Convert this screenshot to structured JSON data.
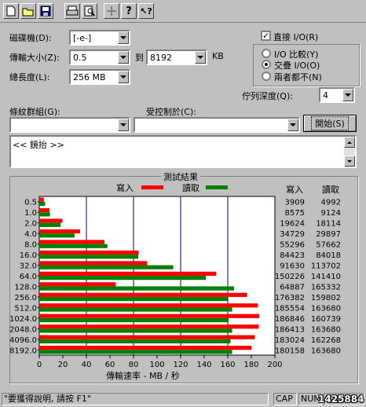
{
  "toolbar": {
    "buttons": [
      {
        "name": "new-file-icon",
        "glyph": "🗋"
      },
      {
        "name": "open-folder-icon",
        "glyph": "📂"
      },
      {
        "name": "save-icon",
        "glyph": "💾"
      },
      {
        "name": "print-icon",
        "glyph": "🖶"
      },
      {
        "name": "print-preview-icon",
        "glyph": "🔍"
      },
      {
        "name": "move-icon",
        "glyph": "✥"
      },
      {
        "name": "help-icon",
        "glyph": "?"
      },
      {
        "name": "context-help-icon",
        "glyph": "↖?"
      }
    ]
  },
  "settings": {
    "drive_label": "磁碟機(D):",
    "drive_value": "[-e-]",
    "transfer_label": "傳輸大小(Z):",
    "transfer_from": "0.5",
    "to_label": "到",
    "transfer_to": "8192",
    "kb_label": "KB",
    "length_label": "總長度(L):",
    "length_value": "256 MB",
    "direct_io_label": "直接 I/O(R)",
    "direct_io_checked": true,
    "radio_io_compare": "I/O 比較(Y)",
    "radio_overlap": "交疊 I/O(O)",
    "radio_neither": "兩者都不(N)",
    "queue_label": "佇列深度(Q):",
    "queue_value": "4",
    "group_label": "條紋群組(G):",
    "control_label": "受控制於(C):",
    "start_button": "開始(S)",
    "log_text": "<< 鏡抬 >>"
  },
  "chart_data": {
    "type": "bar",
    "title": "測試結果",
    "legend": [
      {
        "name": "寫入",
        "color": "#ff0000"
      },
      {
        "name": "讀取",
        "color": "#008000"
      }
    ],
    "xlabel": "傳輸速率 - MB / 秒",
    "xlim": [
      0,
      200
    ],
    "xticks": [
      "0",
      "20",
      "40",
      "60",
      "80",
      "100",
      "120",
      "140",
      "160",
      "180",
      "200"
    ],
    "categories": [
      "0.5",
      "1.0",
      "2.0",
      "4.0",
      "8.0",
      "16.0",
      "32.0",
      "64.0",
      "128.0",
      "256.0",
      "512.0",
      "1024.0",
      "2048.0",
      "4096.0",
      "8192.0"
    ],
    "series": [
      {
        "name": "寫入",
        "color": "#ff0000",
        "values": [
          3.9,
          8.6,
          19.6,
          34.7,
          55.3,
          84.4,
          91.6,
          150.2,
          64.9,
          176.4,
          185.6,
          186.8,
          186.4,
          183.0,
          180.2
        ]
      },
      {
        "name": "讀取",
        "color": "#008000",
        "values": [
          5.0,
          9.1,
          18.1,
          29.9,
          57.8,
          84.0,
          113.7,
          141.4,
          165.3,
          159.8,
          163.7,
          160.7,
          163.7,
          162.3,
          163.7
        ]
      }
    ],
    "table_headers": {
      "write": "寫入",
      "read": "讀取"
    },
    "write_values": [
      "3909",
      "8575",
      "19624",
      "34729",
      "55296",
      "84423",
      "91630",
      "150226",
      "64887",
      "176382",
      "185554",
      "186846",
      "186413",
      "183024",
      "180158"
    ],
    "read_values": [
      "4992",
      "9124",
      "18114",
      "29897",
      "57662",
      "84018",
      "113702",
      "141410",
      "165332",
      "159802",
      "163680",
      "160739",
      "163680",
      "162268",
      "163680"
    ],
    "grid": true
  },
  "status": {
    "help_text": "\"要獲得說明, 請按 F1\"",
    "cap": "CAP",
    "num": "NUM",
    "watermark": "1425884"
  },
  "colors": {
    "write": "#ff0000",
    "read": "#008000",
    "grid": "#000080",
    "plot_bg": "#ffffff",
    "window_bg": "#c0c0c0"
  }
}
